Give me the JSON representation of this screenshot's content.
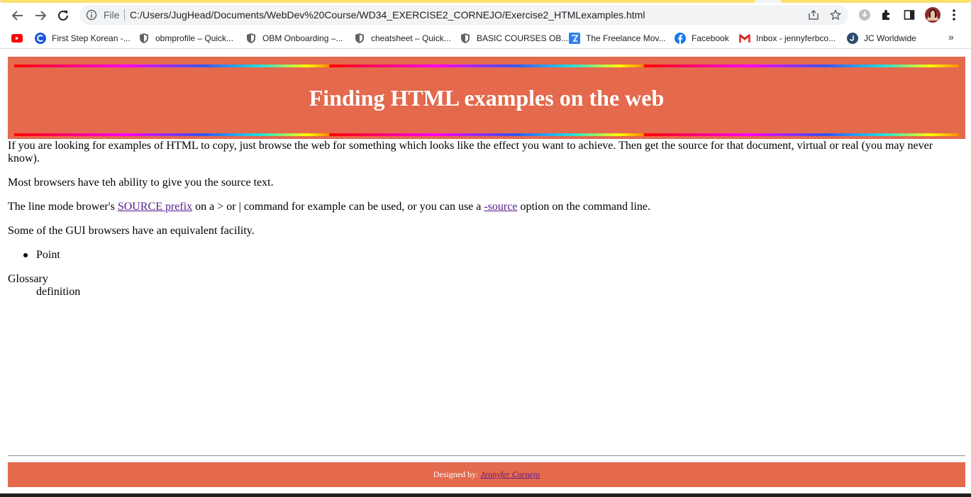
{
  "browser": {
    "address_scheme": "File",
    "url": "C:/Users/JugHead/Documents/WebDev%20Course/WD34_EXERCISE2_CORNEJO/Exercise2_HTMLexamples.html",
    "bookmarks": [
      {
        "icon": "youtube-icon",
        "label": ""
      },
      {
        "icon": "c-logo-icon",
        "label": "First Step Korean -..."
      },
      {
        "icon": "shield-icon",
        "label": "obmprofile – Quick..."
      },
      {
        "icon": "shield-icon",
        "label": "OBM Onboarding –..."
      },
      {
        "icon": "shield-icon",
        "label": "cheatsheet – Quick..."
      },
      {
        "icon": "shield-icon",
        "label": "BASIC COURSES OB..."
      },
      {
        "icon": "freelance-icon",
        "label": "The Freelance Mov..."
      },
      {
        "icon": "facebook-icon",
        "label": "Facebook"
      },
      {
        "icon": "gmail-icon",
        "label": "Inbox - jennyferbco..."
      },
      {
        "icon": "jc-icon",
        "label": "JC Worldwide"
      }
    ],
    "more_label": "»"
  },
  "page": {
    "heading": "Finding HTML examples on the web",
    "p1": "If you are looking for examples of HTML to copy, just browse the web for something which looks like the effect you want to achieve. Then get the source for that document, virtual or real (you may never know).",
    "p2": "Most browsers have teh ability to give you the source text.",
    "p3_before": "The line mode brower's ",
    "p3_link1": "SOURCE prefix",
    "p3_middle": " on a > or | command for example can be used, or you can use a ",
    "p3_link2": "-source",
    "p3_after": " option on the command line.",
    "p4": "Some of the GUI browsers have an equivalent facility.",
    "list_item": "Point",
    "glossary_term": "Glossary",
    "glossary_definition": "definition",
    "footer_prefix": "Designed by: ",
    "footer_link": "Jennyfer Cornejo"
  },
  "colors": {
    "banner": "#e4694d",
    "link_visited": "#551a8b"
  }
}
